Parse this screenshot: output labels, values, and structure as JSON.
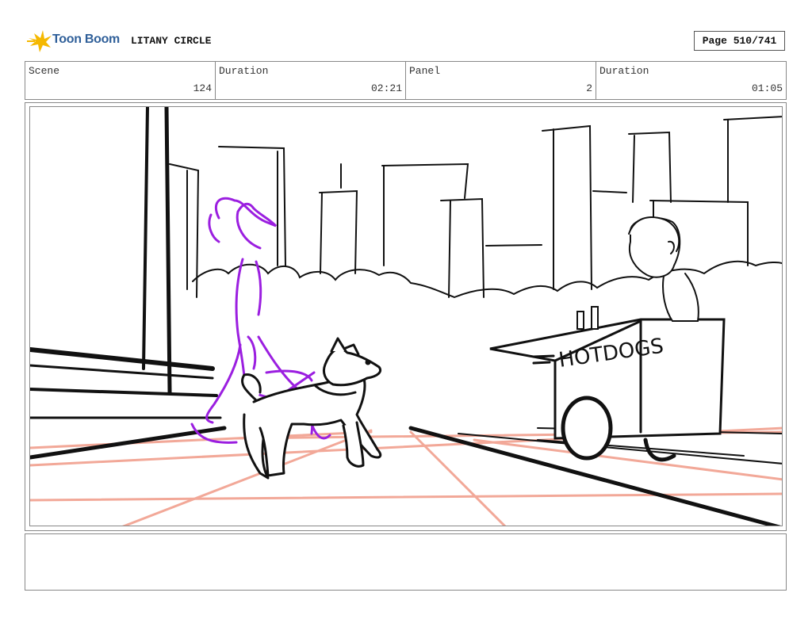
{
  "header": {
    "brand": "Toon Boom",
    "project_title": "LITANY CIRCLE",
    "page_label": "Page 510/741"
  },
  "info": {
    "scene_label": "Scene",
    "scene_value": "124",
    "scene_duration_label": "Duration",
    "scene_duration_value": "02:21",
    "panel_label": "Panel",
    "panel_value": "2",
    "panel_duration_label": "Duration",
    "panel_duration_value": "01:05"
  },
  "panel": {
    "sign_text": "HOTDOGS"
  },
  "colors": {
    "sketch": "#111111",
    "character": "#9b1fe0",
    "perspective": "#f2a898",
    "brand": "#2f5f99",
    "logo_star": "#f5b800"
  },
  "notes": {
    "text": ""
  }
}
